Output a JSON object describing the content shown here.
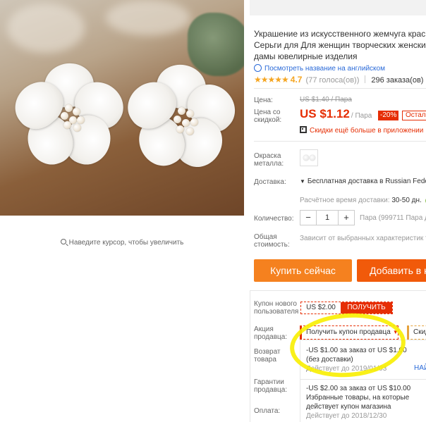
{
  "gallery": {
    "zoom_hint": "Наведите курсор, чтобы увеличить",
    "main_image_alt": "white flower pearl stud earrings"
  },
  "product": {
    "title_line1": "Украшение из искусственного жемчуга краси",
    "title_line2": "Серьги для Для женщин творческих женский",
    "title_line3": "дамы ювелирные изделия",
    "translate_link": "Посмотреть название на английском",
    "rating_stars": "★★★★★",
    "rating_value": "4.7",
    "rating_votes": "(77 голоса(ов))",
    "orders": "296 заказа(ов)"
  },
  "pricing": {
    "label_price": "Цена:",
    "old_price": "US $1.40 / Пара",
    "label_discount_price": "Цена со скидкой:",
    "price": "US $1.12",
    "price_unit": "/ Пара",
    "discount_badge": "-20%",
    "stock_label": "Остало",
    "app_promo": "Скидки ещё больше в приложении",
    "accent_color": "#e62e04"
  },
  "options": {
    "label_color": "Окраска металла:",
    "label_shipping": "Доставка:",
    "shipping_text": "Бесплатная доставка в Russian Federa",
    "shipping_time_label": "Расчётное время доставки:",
    "shipping_time_value": "30-50 дн.",
    "label_qty": "Количество:",
    "qty_minus": "−",
    "qty_value": "1",
    "qty_plus": "+",
    "availability": "Пара (999711 Пара д",
    "label_total": "Общая стоимость:",
    "total_note": "Зависит от выбранных характеристик това"
  },
  "actions": {
    "buy_now": "Купить сейчас",
    "add_to_cart": "Добавить в к"
  },
  "coupons": {
    "label_new_user": "Купон нового пользователя",
    "new_user_amount": "US $2.00",
    "new_user_get": "ПОЛУЧИТЬ",
    "label_seller_promo": "Акция продавца:",
    "get_seller_coupon": "Получить купон продавца",
    "other_promo": "Скид",
    "label_return": "Возврат товара",
    "label_guarantee": "Гарантии продавца:",
    "label_payment": "Оплата:",
    "coupon1_line1": "-US $1.00 за заказ от US $1.00",
    "coupon1_line2": "(без доставки)",
    "coupon1_valid": "Действует до 2019/01/03",
    "coupon2_line1": "-US $2.00 за заказ от US $10.00",
    "coupon2_line2": "Избранные товары, на которые",
    "coupon2_line3": "действует купон магазина",
    "coupon2_valid": "Действует до 2018/12/30",
    "get_link": "НАЙ",
    "highlight_color": "#f8ee00"
  }
}
